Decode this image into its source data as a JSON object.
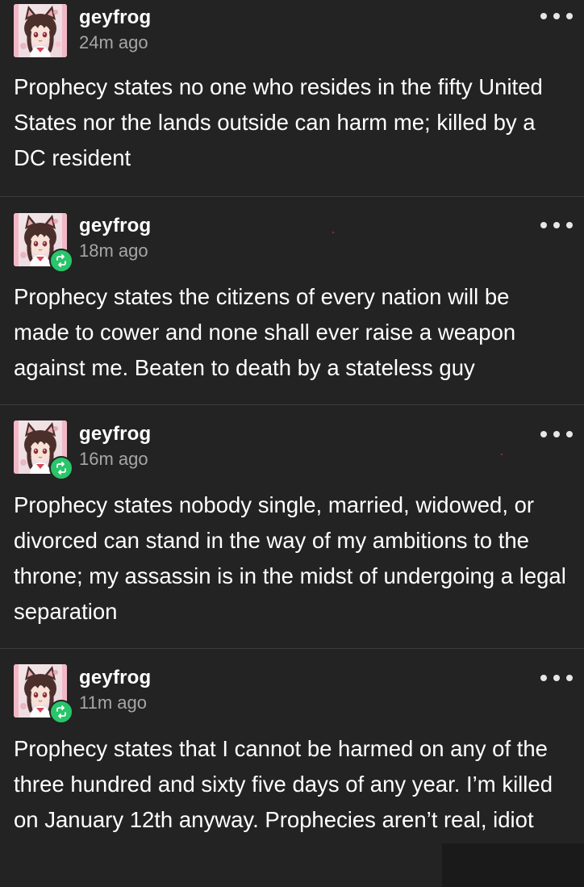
{
  "posts": [
    {
      "username": "geyfrog",
      "time": "24m ago",
      "reblogged": false,
      "text": "Prophecy states no one who resides in the fifty United States nor the lands outside can harm me; killed by a DC resident"
    },
    {
      "username": "geyfrog",
      "time": "18m ago",
      "reblogged": true,
      "text": "Prophecy states the citizens of every nation will be made to cower and none shall ever raise a weapon against me. Beaten to death by a stateless guy"
    },
    {
      "username": "geyfrog",
      "time": "16m ago",
      "reblogged": true,
      "text": "Prophecy states nobody single, married, widowed, or divorced can stand in the way of my ambitions to the throne; my assassin is in the midst of undergoing a legal separation"
    },
    {
      "username": "geyfrog",
      "time": "11m ago",
      "reblogged": true,
      "text": "Prophecy states that I cannot be harmed on any of the three hundred and sixty five days of any year. I’m killed on January 12th anyway. Prophecies aren’t real, idiot"
    }
  ],
  "icons": {
    "more": "more-options-icon",
    "reblog": "reblog-icon",
    "avatar": "avatar"
  },
  "colors": {
    "background": "#232323",
    "text": "#ffffff",
    "timestamp": "#a6a6a6",
    "reblog_badge": "#29c56a",
    "divider": "#3c3c3c"
  }
}
